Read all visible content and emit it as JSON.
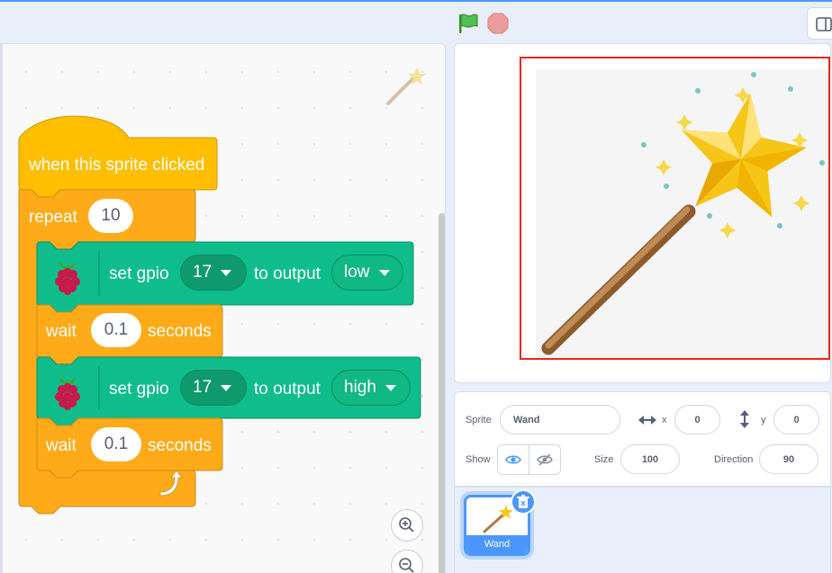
{
  "colors": {
    "events": "#ffbf00",
    "control": "#ffab19",
    "extension": "#0fbd8c",
    "accent": "#4c97ff",
    "highlight": "#e8271f"
  },
  "icons": [
    "green-flag-icon",
    "stop-icon",
    "layout-toggle-icon",
    "raspberry-pi-icon",
    "loop-arrow-icon",
    "zoom-in-icon",
    "zoom-out-icon",
    "eye-icon",
    "eye-off-icon",
    "resize-horizontal-icon",
    "resize-vertical-icon",
    "trash-icon",
    "magic-wand-icon"
  ],
  "code": {
    "hat": {
      "label": "when this sprite clicked"
    },
    "repeat": {
      "label": "repeat",
      "count": "10"
    },
    "set_low": {
      "label": "set gpio",
      "pin": "17",
      "mid": "to output",
      "state": "low"
    },
    "wait1": {
      "label": "wait",
      "value": "0.1",
      "unit": "seconds"
    },
    "set_high": {
      "label": "set gpio",
      "pin": "17",
      "mid": "to output",
      "state": "high"
    },
    "wait2": {
      "label": "wait",
      "value": "0.1",
      "unit": "seconds"
    }
  },
  "sprite_info": {
    "sprite_label": "Sprite",
    "sprite_name": "Wand",
    "x_label": "x",
    "x_value": "0",
    "y_label": "y",
    "y_value": "0",
    "show_label": "Show",
    "size_label": "Size",
    "size_value": "100",
    "direction_label": "Direction",
    "direction_value": "90"
  },
  "sprite_list": [
    {
      "name": "Wand",
      "selected": true
    }
  ]
}
